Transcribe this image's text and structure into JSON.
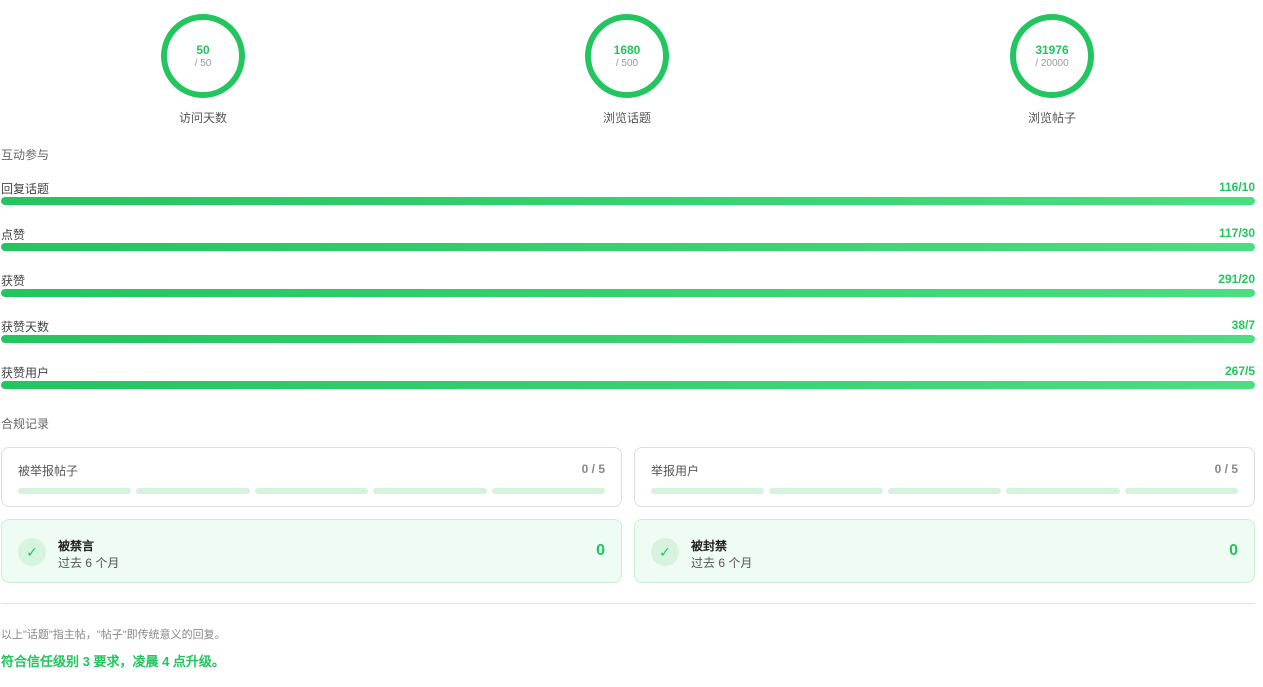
{
  "stats": [
    {
      "value": "50",
      "target": "/ 50",
      "label": "访问天数"
    },
    {
      "value": "1680",
      "target": "/ 500",
      "label": "浏览话题"
    },
    {
      "value": "31976",
      "target": "/ 20000",
      "label": "浏览帖子"
    }
  ],
  "engagement": {
    "title": "互动参与",
    "rows": [
      {
        "label": "回复话题",
        "value": "116/10",
        "progress": 1.0
      },
      {
        "label": "点赞",
        "value": "117/30",
        "progress": 1.0
      },
      {
        "label": "获赞",
        "value": "291/20",
        "progress": 1.0
      },
      {
        "label": "获赞天数",
        "value": "38/7",
        "progress": 1.0
      },
      {
        "label": "获赞用户",
        "value": "267/5",
        "progress": 1.0
      }
    ]
  },
  "compliance": {
    "title": "合规记录",
    "reports": [
      {
        "label": "被举报帖子",
        "count": "0 / 5"
      },
      {
        "label": "举报用户",
        "count": "0 / 5"
      }
    ],
    "status": [
      {
        "title": "被禁言",
        "sub": "过去 6 个月",
        "count": "0",
        "icon": "check-icon"
      },
      {
        "title": "被封禁",
        "sub": "过去 6 个月",
        "count": "0",
        "icon": "check-icon"
      }
    ]
  },
  "footer": {
    "note": "以上\"话题\"指主帖，\"帖子\"即传统意义的回复。",
    "result": "符合信任级别 3 要求，凌晨 4 点升级。"
  },
  "colors": {
    "accent": "#22c55e",
    "track": "#dcf7e5",
    "status_bg": "#effcf3"
  }
}
